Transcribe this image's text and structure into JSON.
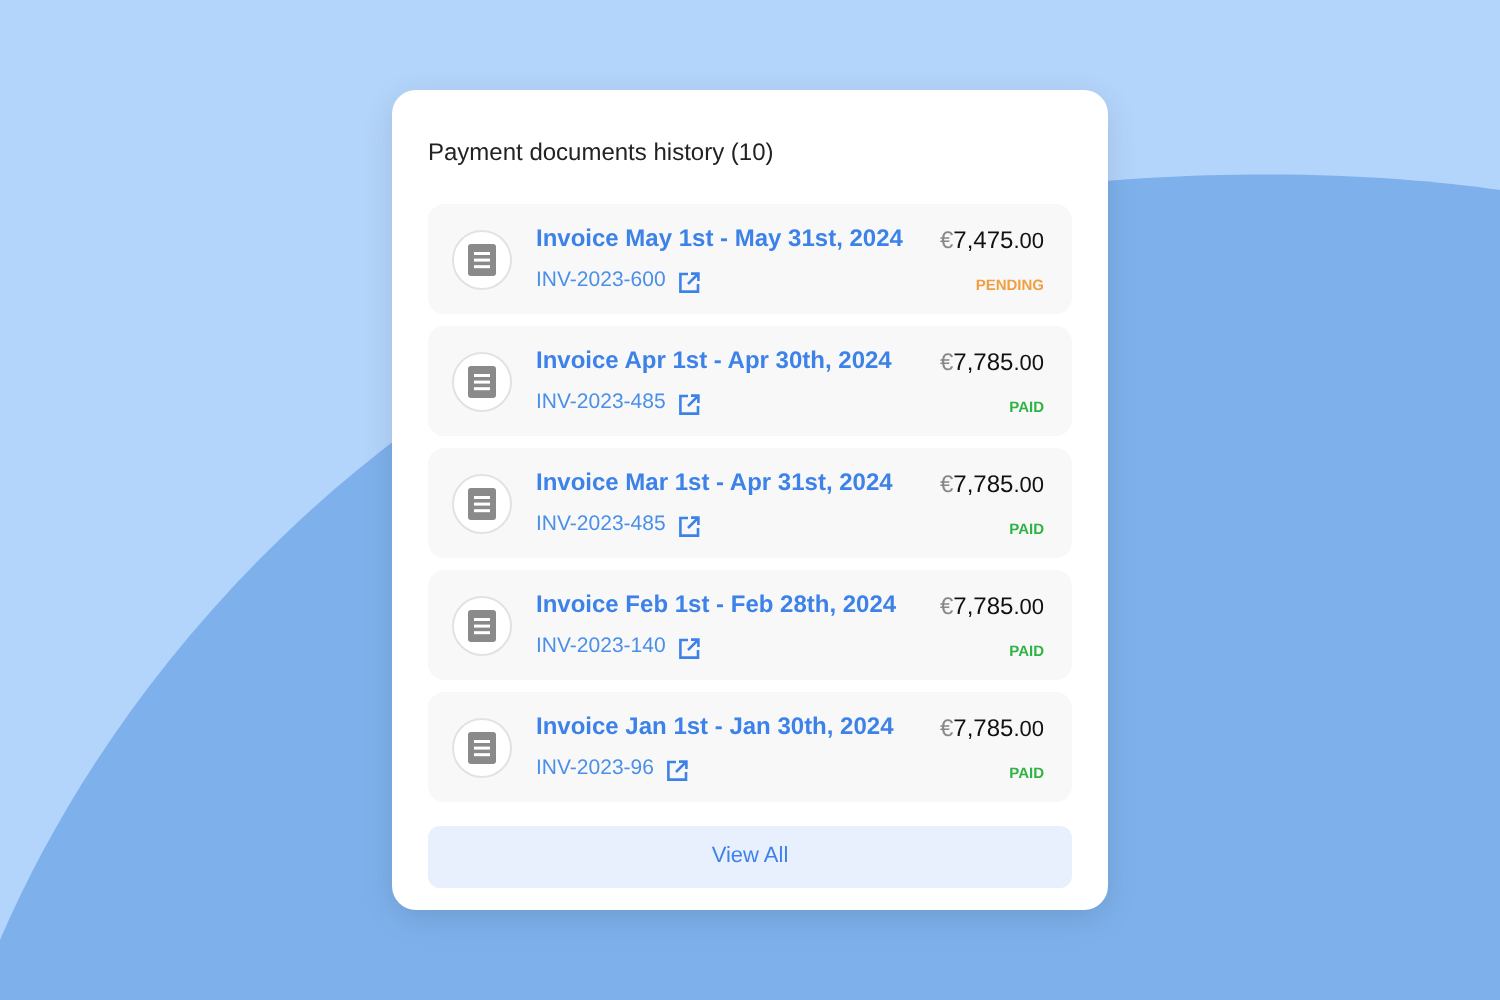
{
  "card": {
    "title": "Payment documents history (10)",
    "invoices": [
      {
        "title": "Invoice May 1st - May 31st, 2024",
        "number": "INV-2023-600",
        "currency": "€",
        "amount": "7,475",
        "cents": ".00",
        "status": "PENDING",
        "kind": "pending"
      },
      {
        "title": "Invoice Apr 1st - Apr 30th, 2024",
        "number": "INV-2023-485",
        "currency": "€",
        "amount": "7,785",
        "cents": ".00",
        "status": "PAID",
        "kind": "paid"
      },
      {
        "title": "Invoice Mar 1st - Apr 31st, 2024",
        "number": "INV-2023-485",
        "currency": "€",
        "amount": "7,785",
        "cents": ".00",
        "status": "PAID",
        "kind": "paid"
      },
      {
        "title": "Invoice Feb 1st - Feb 28th, 2024",
        "number": "INV-2023-140",
        "currency": "€",
        "amount": "7,785",
        "cents": ".00",
        "status": "PAID",
        "kind": "paid"
      },
      {
        "title": "Invoice Jan 1st - Jan 30th, 2024",
        "number": "INV-2023-96",
        "currency": "€",
        "amount": "7,785",
        "cents": ".00",
        "status": "PAID",
        "kind": "paid"
      }
    ],
    "button": "View All"
  }
}
